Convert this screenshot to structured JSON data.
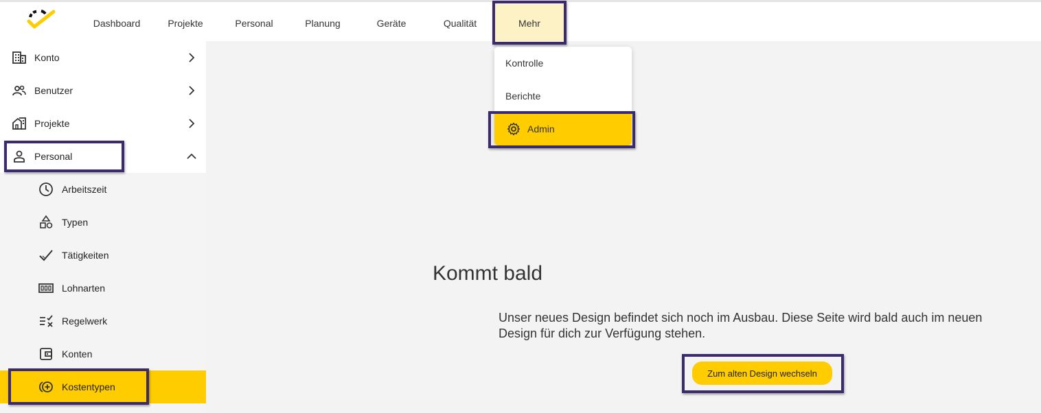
{
  "topnav": {
    "items": [
      {
        "label": "Dashboard"
      },
      {
        "label": "Projekte"
      },
      {
        "label": "Personal"
      },
      {
        "label": "Planung"
      },
      {
        "label": "Geräte"
      },
      {
        "label": "Qualität"
      },
      {
        "label": "Mehr",
        "active": true
      }
    ]
  },
  "dropdown": {
    "items": [
      {
        "label": "Kontrolle"
      },
      {
        "label": "Berichte"
      },
      {
        "label": "Admin",
        "icon": "gear-icon",
        "active": true
      }
    ]
  },
  "sidebar": {
    "items": [
      {
        "label": "Konto",
        "icon": "building-icon",
        "expanded": false
      },
      {
        "label": "Benutzer",
        "icon": "users-icon",
        "expanded": false
      },
      {
        "label": "Projekte",
        "icon": "house-icon",
        "expanded": false
      },
      {
        "label": "Personal",
        "icon": "person-icon",
        "expanded": true
      }
    ],
    "subitems": [
      {
        "label": "Arbeitszeit",
        "icon": "clock-icon"
      },
      {
        "label": "Typen",
        "icon": "shapes-icon"
      },
      {
        "label": "Tätigkeiten",
        "icon": "check-icon"
      },
      {
        "label": "Lohnarten",
        "icon": "counter-icon"
      },
      {
        "label": "Regelwerk",
        "icon": "rules-icon"
      },
      {
        "label": "Konten",
        "icon": "wallet-icon"
      },
      {
        "label": "Kostentypen",
        "icon": "add-coin-icon",
        "active": true
      }
    ]
  },
  "main": {
    "title": "Kommt bald",
    "message": "Unser neues Design befindet sich noch im Ausbau. Diese Seite wird bald auch im neuen Design für dich zur Verfügung stehen.",
    "button_label": "Zum alten Design wechseln"
  },
  "colors": {
    "accent": "#ffcc00",
    "highlight_border": "#3b2a6e",
    "active_tab_bg": "#fdf2c6"
  }
}
